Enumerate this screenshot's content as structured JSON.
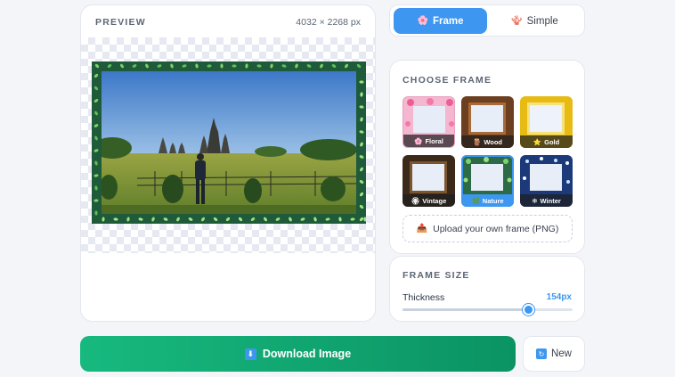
{
  "preview": {
    "title": "PREVIEW",
    "dimensions": "4032 × 2268 px"
  },
  "tabs": [
    {
      "label": "Frame",
      "icon": "flower-icon",
      "active": true
    },
    {
      "label": "Simple",
      "icon": "frame-icon",
      "active": false
    }
  ],
  "choose_frame": {
    "title": "CHOOSE FRAME",
    "frames": [
      {
        "label": "Floral",
        "icon": "flower-icon",
        "selected": false
      },
      {
        "label": "Wood",
        "icon": "wood-icon",
        "selected": false
      },
      {
        "label": "Gold",
        "icon": "star-icon",
        "selected": false
      },
      {
        "label": "Vintage",
        "icon": "vintage-icon",
        "selected": false
      },
      {
        "label": "Nature",
        "icon": "leaf-icon",
        "selected": true
      },
      {
        "label": "Winter",
        "icon": "snowflake-icon",
        "selected": false
      }
    ],
    "upload_label": "Upload your own frame (PNG)"
  },
  "frame_size": {
    "title": "FRAME SIZE",
    "thickness_label": "Thickness",
    "thickness_value": "154px",
    "slider_fraction": 0.74
  },
  "actions": {
    "download_label": "Download Image",
    "new_label": "New"
  },
  "colors": {
    "accent": "#3d96f0",
    "download": "#10a871",
    "nature_frame": "#1f5a3a"
  }
}
